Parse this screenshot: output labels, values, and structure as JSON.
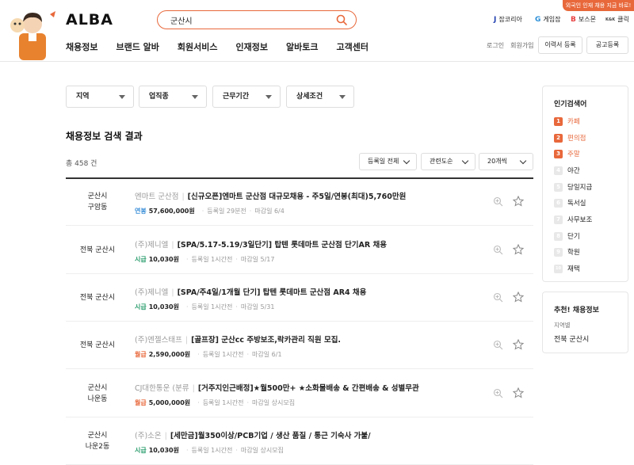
{
  "header": {
    "logo": "ALBA",
    "search_value": "군산시",
    "promo_banner": "외국인 인재 채용 지금 바로!",
    "partners": [
      {
        "glyph": "J",
        "label": "잡코리아",
        "color": "#1f3fb0"
      },
      {
        "glyph": "G",
        "label": "게임잡",
        "color": "#2a8fd8"
      },
      {
        "glyph": "B",
        "label": "보스몬",
        "color": "#e84040"
      },
      {
        "glyph": "K&K",
        "label": "클릭",
        "color": "#444444"
      }
    ],
    "nav": [
      "채용정보",
      "브랜드 알바",
      "회원서비스",
      "인재정보",
      "알바토크",
      "고객센터"
    ],
    "login": "로그인",
    "signup": "회원가입",
    "resume_button": "이력서 등록",
    "post_button": "공고등록"
  },
  "filters": [
    "지역",
    "업직종",
    "근무기간",
    "상세조건"
  ],
  "results": {
    "section_title": "채용정보 검색 결과",
    "total": "총 458 건",
    "sort_options": [
      "등록일 전체",
      "관련도순",
      "20개씩"
    ],
    "rows": [
      {
        "location": [
          "군산시",
          "구암동"
        ],
        "company": "엔마트 군산점",
        "title": "[신규오픈]엔마트 군산점 대규모채용 - 주5일/연봉(최대)5,760만원",
        "pay_type": "연봉",
        "pay_class": "pay-y",
        "pay": "57,600,000원",
        "registered": "등록일 29분전",
        "deadline": "마감일 6/4"
      },
      {
        "location": [
          "전북 군산시"
        ],
        "company": "(주)제니엘",
        "title": "[SPA/5.17-5.19/3일단기] 탑텐 롯데마트 군산점 단기AR 채용",
        "pay_type": "시급",
        "pay_class": "pay-h",
        "pay": "10,030원",
        "registered": "등록일 1시간전",
        "deadline": "마감일 5/17"
      },
      {
        "location": [
          "전북 군산시"
        ],
        "company": "(주)제니엘",
        "title": "[SPA/주4일/1개월 단기] 탑텐 롯데마트 군산점 AR4 채용",
        "pay_type": "시급",
        "pay_class": "pay-h",
        "pay": "10,030원",
        "registered": "등록일 1시간전",
        "deadline": "마감일 5/31"
      },
      {
        "location": [
          "전북 군산시"
        ],
        "company": "(주)엔젤스태프",
        "title": "[골프장] 군산cc 주방보조,락카관리 직원 모집.",
        "pay_type": "월급",
        "pay_class": "pay-m",
        "pay": "2,590,000원",
        "registered": "등록일 1시간전",
        "deadline": "마감일 6/1"
      },
      {
        "location": [
          "군산시",
          "나운동"
        ],
        "company": "CJ대한통운 (분류",
        "title": "[거주지인근배정]★월500만+ ★소화물배송 & 간편배송 & 성별무관",
        "pay_type": "월급",
        "pay_class": "pay-m",
        "pay": "5,000,000원",
        "registered": "등록일 1시간전",
        "deadline": "마감일 상시모집"
      },
      {
        "location": [
          "군산시",
          "나운2동"
        ],
        "company": "(주)소온",
        "title": "[세만금]월350이상/PCB기업 / 생산 품질 / 통근 기숙사 가불/",
        "pay_type": "시급",
        "pay_class": "pay-h",
        "pay": "10,030원",
        "registered": "등록일 1시간전",
        "deadline": "마감일 상시모집"
      }
    ]
  },
  "sidebar": {
    "popular_title": "인기검색어",
    "keywords": [
      "카페",
      "편의점",
      "주말",
      "야간",
      "당일지급",
      "독서실",
      "사무보조",
      "단기",
      "학원",
      "재택"
    ],
    "recommend_title": "추천! 채용정보",
    "recommend_sub": "지역별",
    "recommend_value": "전북 군산시"
  },
  "colors": {
    "accent": "#e8683b"
  }
}
